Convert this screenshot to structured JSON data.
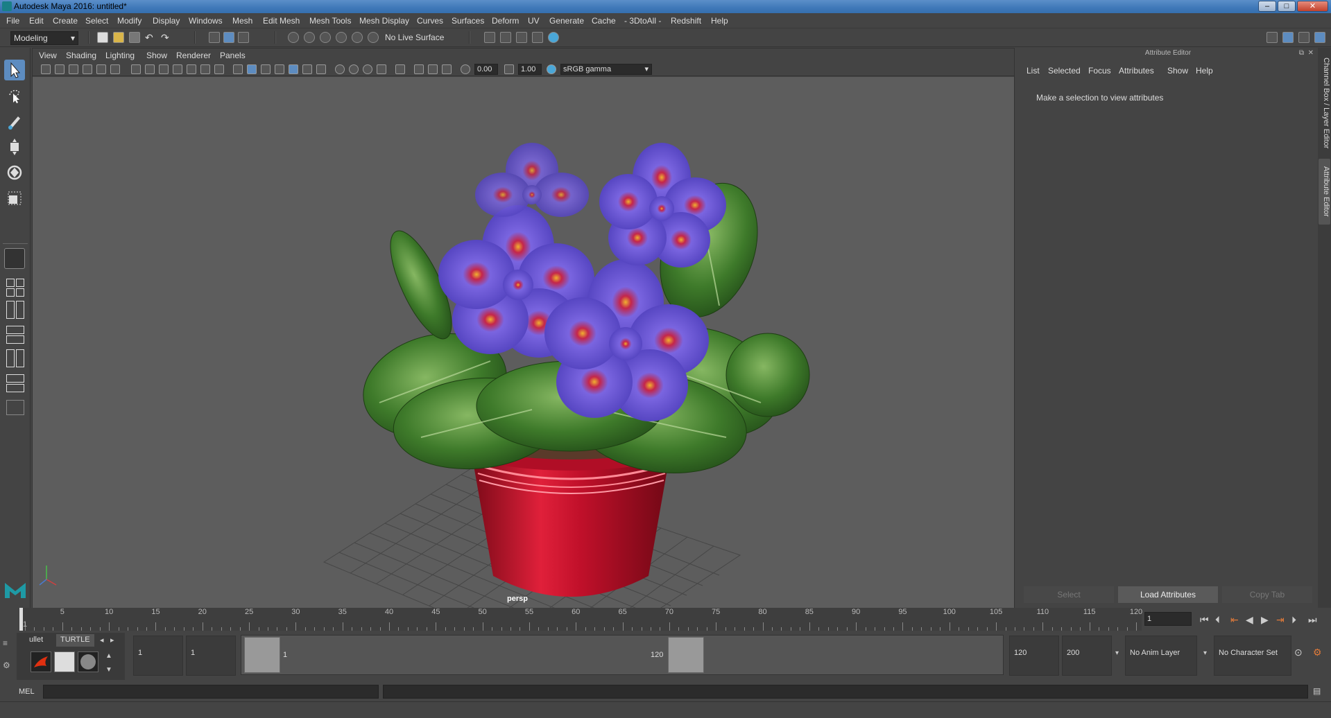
{
  "window": {
    "title": "Autodesk Maya 2016: untitled*",
    "min": "–",
    "max": "□",
    "close": "✕"
  },
  "menu": [
    "File",
    "Edit",
    "Create",
    "Select",
    "Modify",
    "Display",
    "Windows",
    "Mesh",
    "Edit Mesh",
    "Mesh Tools",
    "Mesh Display",
    "Curves",
    "Surfaces",
    "Deform",
    "UV",
    "Generate",
    "Cache",
    "- 3DtoAll -",
    "Redshift",
    "Help"
  ],
  "toolbar": {
    "mode": "Modeling",
    "live_surface": "No Live Surface"
  },
  "viewport": {
    "menu": [
      "View",
      "Shading",
      "Lighting",
      "Show",
      "Renderer",
      "Panels"
    ],
    "exposure": "0.00",
    "gamma": "1.00",
    "colorspace": "sRGB gamma",
    "camera_label": "persp"
  },
  "attribute_editor": {
    "header": "Attribute Editor",
    "menu": [
      "List",
      "Selected",
      "Focus",
      "Attributes",
      "Show",
      "Help"
    ],
    "message": "Make a selection to view attributes",
    "buttons": {
      "select": "Select",
      "load": "Load Attributes",
      "copy": "Copy Tab"
    }
  },
  "side_tabs": {
    "channel_box": "Channel Box / Layer Editor",
    "attribute_editor": "Attribute Editor"
  },
  "timeline": {
    "ticks": [
      "1",
      "5",
      "10",
      "15",
      "20",
      "25",
      "30",
      "35",
      "40",
      "45",
      "50",
      "55",
      "60",
      "65",
      "70",
      "75",
      "80",
      "85",
      "90",
      "95",
      "100",
      "105",
      "110",
      "115",
      "120"
    ],
    "current_frame": "1"
  },
  "range": {
    "shelf_tabs": [
      "ullet",
      "TURTLE"
    ],
    "start": "1",
    "anim_start": "1",
    "slider_start": "1",
    "slider_end": "120",
    "anim_end": "120",
    "end": "200",
    "anim_layer": "No Anim Layer",
    "character_set": "No Character Set"
  },
  "command": {
    "language": "MEL"
  },
  "colors": {
    "accent": "#5d8cc0",
    "viewport_bg": "#5d5d5d",
    "pot": "#c0102a",
    "petal": "#6b5bd6",
    "leaf": "#3f7d2a"
  }
}
